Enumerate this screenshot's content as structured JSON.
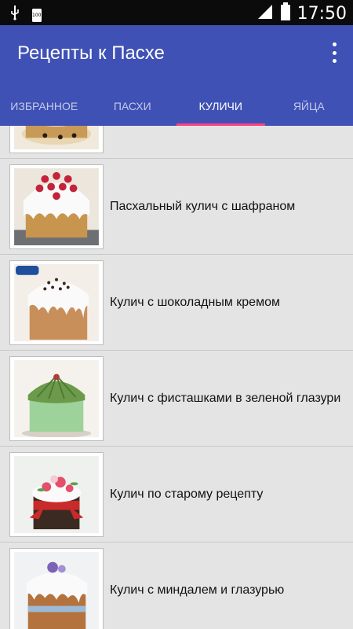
{
  "status": {
    "time": "17:50",
    "notif_badge": "100"
  },
  "app": {
    "title": "Рецепты к Пасхе"
  },
  "tabs": [
    {
      "label": "ИЗБРАННОЕ"
    },
    {
      "label": "ПАСХИ"
    },
    {
      "label": "КУЛИЧИ"
    },
    {
      "label": "ЯЙЦА"
    }
  ],
  "active_tab": "КУЛИЧИ",
  "items": [
    {
      "title": ""
    },
    {
      "title": "Пасхальный кулич с шафраном"
    },
    {
      "title": "Кулич с шоколадным кремом"
    },
    {
      "title": "Кулич с фисташками в зеленой глазури"
    },
    {
      "title": "Кулич по старому рецепту"
    },
    {
      "title": "Кулич с миндалем и глазурью"
    }
  ],
  "colors": {
    "appbar": "#3f51b5",
    "indicator": "#ff4081",
    "statusbar": "#0b0b0b",
    "list_bg": "#e4e4e4"
  }
}
